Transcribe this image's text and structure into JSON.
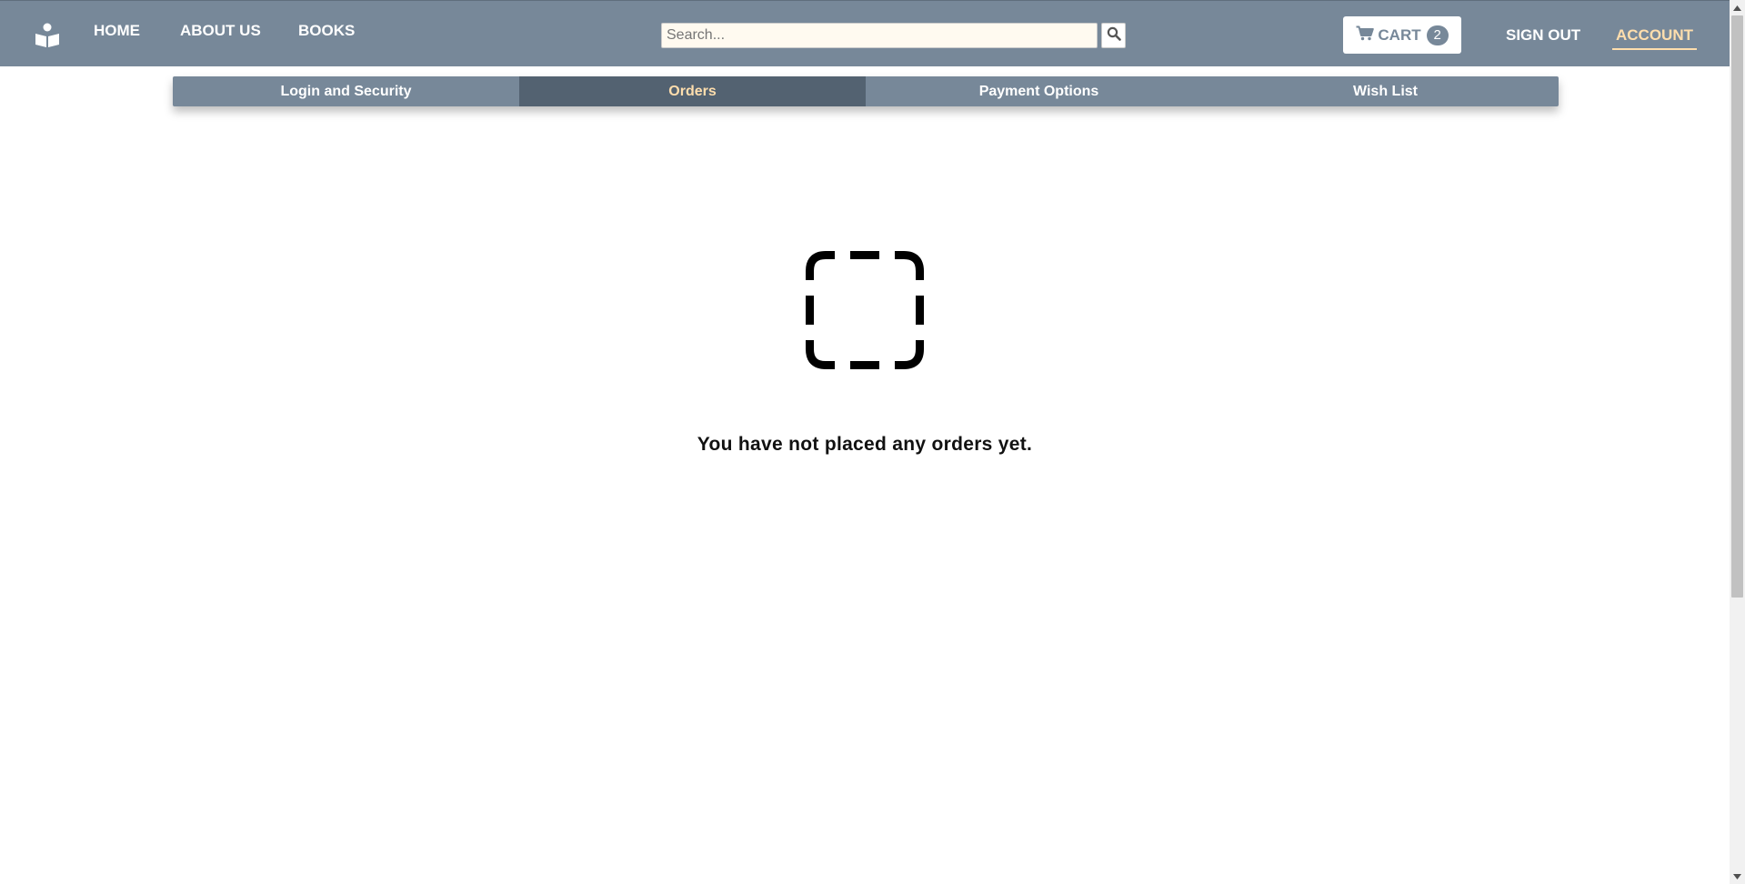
{
  "nav": {
    "logo_icon": "book-reader-icon",
    "links": [
      {
        "label": "HOME"
      },
      {
        "label": "ABOUT US"
      },
      {
        "label": "BOOKS"
      }
    ],
    "search": {
      "placeholder": "Search...",
      "value": "",
      "button_icon": "search-icon"
    },
    "cart": {
      "label": "CART",
      "count": "2",
      "icon": "shopping-cart-icon"
    },
    "sign_out": "SIGN OUT",
    "account": "ACCOUNT"
  },
  "tabs": [
    {
      "label": "Login and Security",
      "active": false
    },
    {
      "label": "Orders",
      "active": true
    },
    {
      "label": "Payment Options",
      "active": false
    },
    {
      "label": "Wish List",
      "active": false
    }
  ],
  "empty_state": {
    "icon": "dashed-square-icon",
    "message": "You have not placed any orders yet."
  },
  "colors": {
    "nav_bg": "#778899",
    "active_tab_bg": "#536271",
    "accent": "#ffdead",
    "search_bg": "#fffaf0"
  }
}
